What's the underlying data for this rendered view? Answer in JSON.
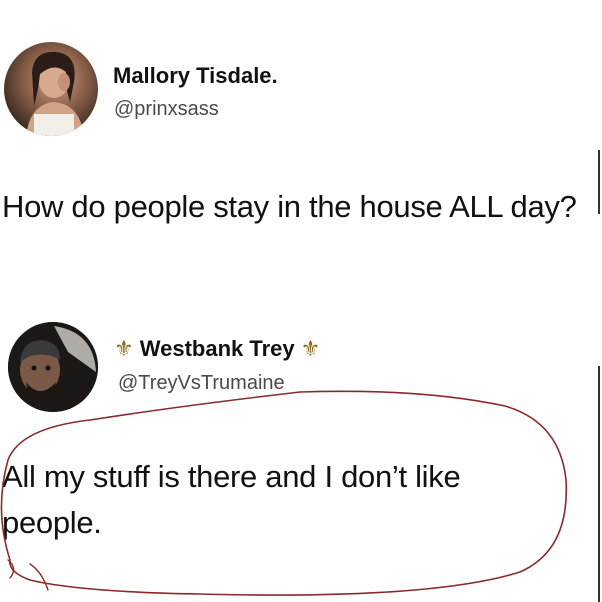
{
  "tweets": [
    {
      "author_name": "Mallory Tisdale.",
      "author_handle": "@prinxsass",
      "text": "How do people stay in the house ALL day?"
    },
    {
      "author_name": "Westbank Trey",
      "author_handle": "@TreyVsTrumaine",
      "name_decoration": "⚜",
      "text": "All my stuff is there and I don’t like people."
    }
  ],
  "annotation_color": "#8b2a2a",
  "decoration_color": "#8a6d1e"
}
